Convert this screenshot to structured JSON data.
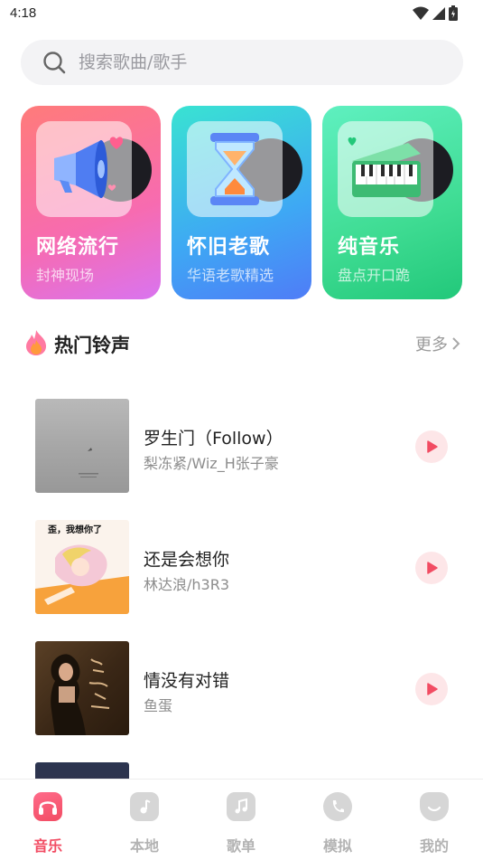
{
  "status_bar": {
    "time": "4:18"
  },
  "search": {
    "placeholder": "搜索歌曲/歌手",
    "icon": "search-icon"
  },
  "categories": [
    {
      "title": "网络流行",
      "subtitle": "封神现场",
      "icon": "megaphone-icon",
      "accent": "#f76bb0"
    },
    {
      "title": "怀旧老歌",
      "subtitle": "华语老歌精选",
      "icon": "hourglass-icon",
      "accent": "#3ea8f4"
    },
    {
      "title": "纯音乐",
      "subtitle": "盘点开口跪",
      "icon": "piano-icon",
      "accent": "#3fdc93"
    }
  ],
  "section": {
    "title": "热门铃声",
    "more_label": "更多",
    "icon": "flame-icon"
  },
  "songs": [
    {
      "title": "罗生门（Follow）",
      "artist": "梨冻紧/Wiz_H张子豪"
    },
    {
      "title": "还是会想你",
      "artist": "林达浪/h3R3",
      "cover_caption": "歪，我想你了"
    },
    {
      "title": "情没有对错",
      "artist": "鱼蛋"
    }
  ],
  "nav": [
    {
      "label": "音乐",
      "icon": "music-app-icon",
      "active": true
    },
    {
      "label": "本地",
      "icon": "local-folder-icon",
      "active": false
    },
    {
      "label": "歌单",
      "icon": "playlist-icon",
      "active": false
    },
    {
      "label": "模拟",
      "icon": "phone-call-icon",
      "active": false
    },
    {
      "label": "我的",
      "icon": "profile-icon",
      "active": false
    }
  ],
  "colors": {
    "accent": "#f24c63",
    "play_bg": "#fde6e8",
    "inactive": "#b3b3b3"
  }
}
